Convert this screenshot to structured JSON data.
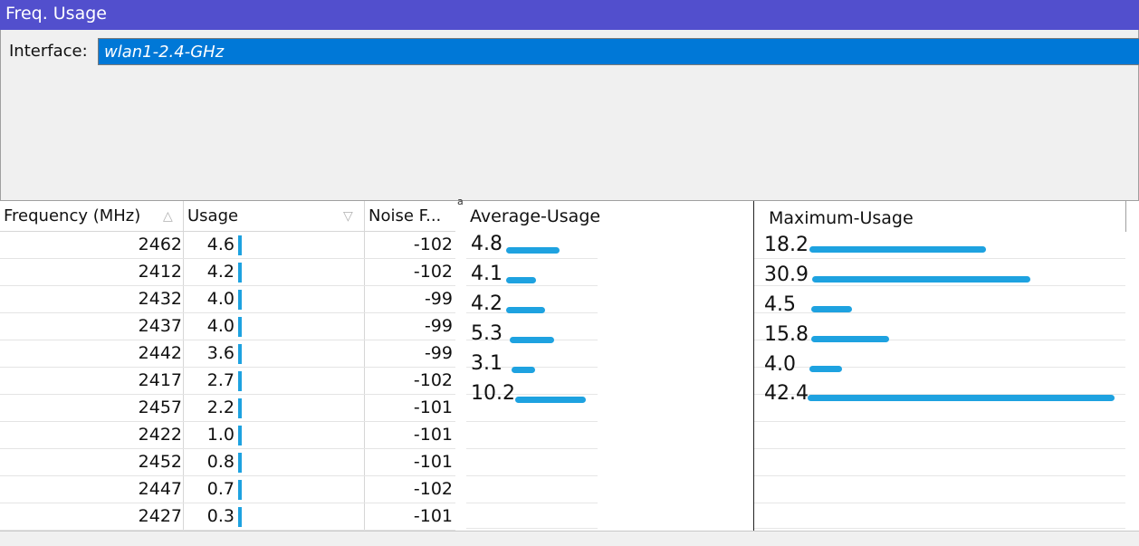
{
  "window": {
    "title": "Freq. Usage"
  },
  "interface": {
    "label": "Interface:",
    "value": "wlan1-2.4-GHz"
  },
  "table": {
    "columns": {
      "frequency": "Frequency (MHz)",
      "usage": "Usage",
      "noise": "Noise F..."
    },
    "rows": [
      {
        "frequency": "2462",
        "usage": "4.6",
        "noise": "-102"
      },
      {
        "frequency": "2412",
        "usage": "4.2",
        "noise": "-102"
      },
      {
        "frequency": "2432",
        "usage": "4.0",
        "noise": "-99"
      },
      {
        "frequency": "2437",
        "usage": "4.0",
        "noise": "-99"
      },
      {
        "frequency": "2442",
        "usage": "3.6",
        "noise": "-99"
      },
      {
        "frequency": "2417",
        "usage": "2.7",
        "noise": "-102"
      },
      {
        "frequency": "2457",
        "usage": "2.2",
        "noise": "-101"
      },
      {
        "frequency": "2422",
        "usage": "1.0",
        "noise": "-101"
      },
      {
        "frequency": "2452",
        "usage": "0.8",
        "noise": "-101"
      },
      {
        "frequency": "2447",
        "usage": "0.7",
        "noise": "-102"
      },
      {
        "frequency": "2427",
        "usage": "0.3",
        "noise": "-101"
      }
    ]
  },
  "annotation_mark": "a",
  "average_usage": {
    "title": "Average-Usage",
    "values": [
      "4.8",
      "4.1",
      "4.2",
      "5.3",
      "3.1",
      "10.2"
    ]
  },
  "maximum_usage": {
    "title": "Maximum-Usage",
    "values": [
      "18.2",
      "30.9",
      "4.5",
      "15.8",
      "4.0",
      "42.4"
    ]
  },
  "colors": {
    "titlebar": "#524fcd",
    "selection": "#0078d7",
    "bar": "#1ea2e0"
  }
}
